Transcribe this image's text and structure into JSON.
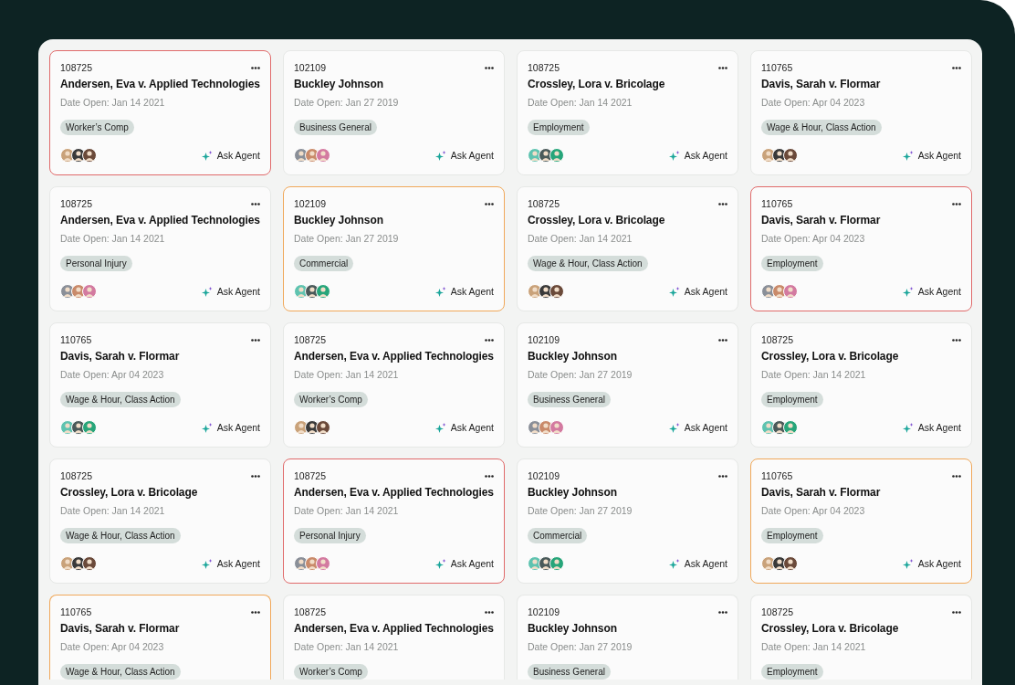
{
  "cases": [
    {
      "number": "108725",
      "title": "Andersen, Eva v. Applied Technologies",
      "date": "Date Open: Jan 14 2021",
      "tag": "Worker’s Comp",
      "color": "#e06a6a",
      "action": "Ask Agent"
    },
    {
      "number": "102109",
      "title": "Buckley Johnson",
      "date": "Date Open: Jan 27 2019",
      "tag": "Business General",
      "action": "Ask Agent"
    },
    {
      "number": "108725",
      "title": "Crossley, Lora v. Bricolage",
      "date": "Date Open: Jan 14 2021",
      "tag": "Employment",
      "action": "Ask Agent"
    },
    {
      "number": "110765",
      "title": "Davis, Sarah v. Flormar",
      "date": "Date Open: Apr 04 2023",
      "tag": "Wage & Hour, Class Action",
      "action": "Ask Agent"
    },
    {
      "number": "108725",
      "title": "Andersen, Eva v. Applied Technologies",
      "date": "Date Open: Jan 14 2021",
      "tag": "Personal Injury",
      "action": "Ask Agent"
    },
    {
      "number": "102109",
      "title": "Buckley Johnson",
      "date": "Date Open: Jan 27 2019",
      "tag": "Commercial",
      "color": "#f0a85a",
      "action": "Ask Agent"
    },
    {
      "number": "108725",
      "title": "Crossley, Lora v. Bricolage",
      "date": "Date Open: Jan 14 2021",
      "tag": "Wage & Hour, Class Action",
      "action": "Ask Agent"
    },
    {
      "number": "110765",
      "title": "Davis, Sarah v. Flormar",
      "date": "Date Open: Apr 04 2023",
      "tag": "Employment",
      "color": "#e06a6a",
      "action": "Ask Agent"
    },
    {
      "number": "110765",
      "title": "Davis, Sarah v. Flormar",
      "date": "Date Open: Apr 04 2023",
      "tag": "Wage & Hour, Class Action",
      "action": "Ask Agent"
    },
    {
      "number": "108725",
      "title": "Andersen, Eva v. Applied Technologies",
      "date": "Date Open: Jan 14 2021",
      "tag": "Worker’s Comp",
      "action": "Ask Agent"
    },
    {
      "number": "102109",
      "title": "Buckley Johnson",
      "date": "Date Open: Jan 27 2019",
      "tag": "Business General",
      "action": "Ask Agent"
    },
    {
      "number": "108725",
      "title": "Crossley, Lora v. Bricolage",
      "date": "Date Open: Jan 14 2021",
      "tag": "Employment",
      "action": "Ask Agent"
    },
    {
      "number": "108725",
      "title": "Crossley, Lora v. Bricolage",
      "date": "Date Open: Jan 14 2021",
      "tag": "Wage & Hour, Class Action",
      "action": "Ask Agent"
    },
    {
      "number": "108725",
      "title": "Andersen, Eva v. Applied Technologies",
      "date": "Date Open: Jan 14 2021",
      "tag": "Personal Injury",
      "color": "#e06a6a",
      "action": "Ask Agent"
    },
    {
      "number": "102109",
      "title": "Buckley Johnson",
      "date": "Date Open: Jan 27 2019",
      "tag": "Commercial",
      "action": "Ask Agent"
    },
    {
      "number": "110765",
      "title": "Davis, Sarah v. Flormar",
      "date": "Date Open: Apr 04 2023",
      "tag": "Employment",
      "color": "#f0a85a",
      "action": "Ask Agent"
    },
    {
      "number": "110765",
      "title": "Davis, Sarah v. Flormar",
      "date": "Date Open: Apr 04 2023",
      "tag": "Wage & Hour, Class Action",
      "color": "#f0a85a"
    },
    {
      "number": "108725",
      "title": "Andersen, Eva v. Applied Technologies",
      "date": "Date Open: Jan 14 2021",
      "tag": "Worker’s Comp"
    },
    {
      "number": "102109",
      "title": "Buckley Johnson",
      "date": "Date Open: Jan 27 2019",
      "tag": "Business General"
    },
    {
      "number": "108725",
      "title": "Crossley, Lora v. Bricolage",
      "date": "Date Open: Jan 14 2021",
      "tag": "Employment"
    }
  ]
}
